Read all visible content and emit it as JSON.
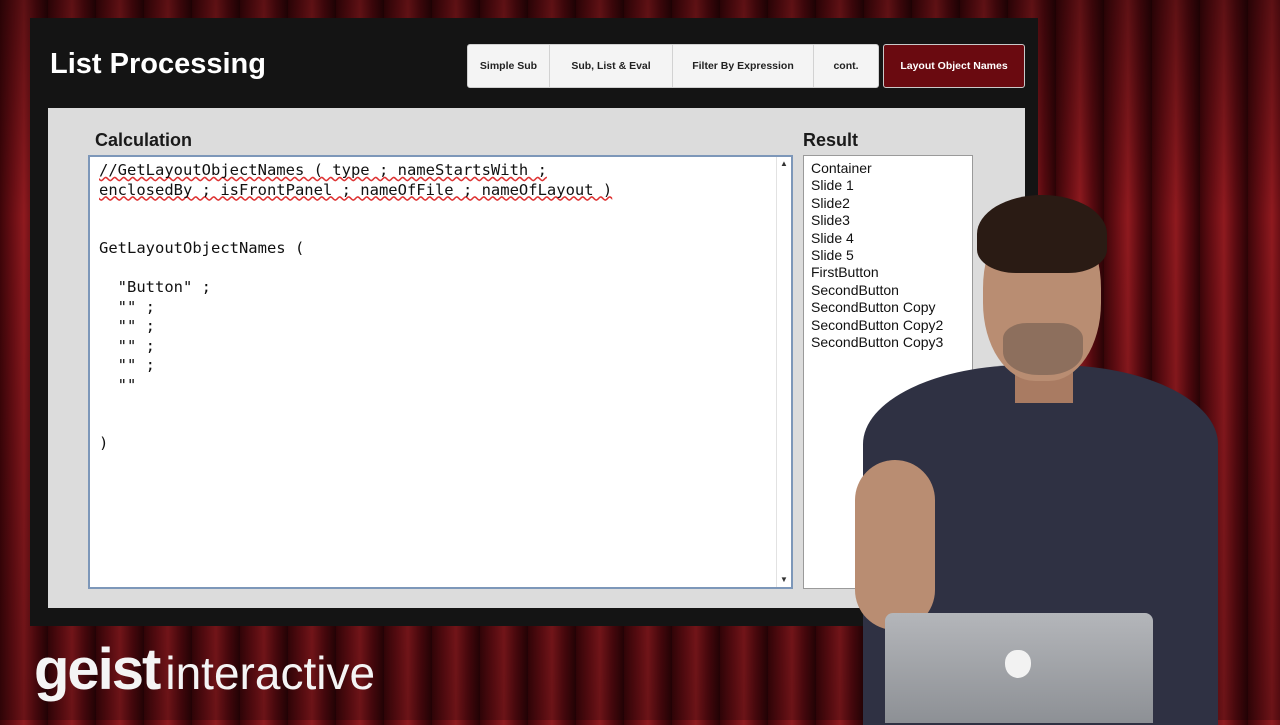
{
  "app": {
    "title": "List Processing",
    "tabs": [
      "Simple Sub",
      "Sub, List & Eval",
      "Filter By Expression",
      "cont."
    ],
    "active_tab": "Layout Object Names",
    "accent_color": "#6a0a10"
  },
  "calculation": {
    "label": "Calculation",
    "lines": [
      "//GetLayoutObjectNames ( type ; nameStartsWith ;",
      "enclosedBy ; isFrontPanel ; nameOfFile ; nameOfLayout )",
      "",
      "",
      "GetLayoutObjectNames (",
      "",
      "  \"Button\" ;",
      "  \"\" ;",
      "  \"\" ;",
      "  \"\" ;",
      "  \"\" ;",
      "  \"\"",
      "",
      "",
      ")"
    ]
  },
  "result": {
    "label": "Result",
    "items": [
      "Container",
      "Slide 1",
      "Slide2",
      "Slide3",
      "Slide 4",
      "Slide 5",
      "FirstButton",
      "SecondButton",
      "SecondButton Copy",
      "SecondButton Copy2",
      "SecondButton Copy3"
    ]
  },
  "logo": {
    "part1": "geist",
    "part2": "interactive"
  },
  "icons": {
    "scroll_up": "scroll-up-arrow-icon",
    "scroll_down": "scroll-down-arrow-icon",
    "laptop_logo": "apple-icon"
  }
}
